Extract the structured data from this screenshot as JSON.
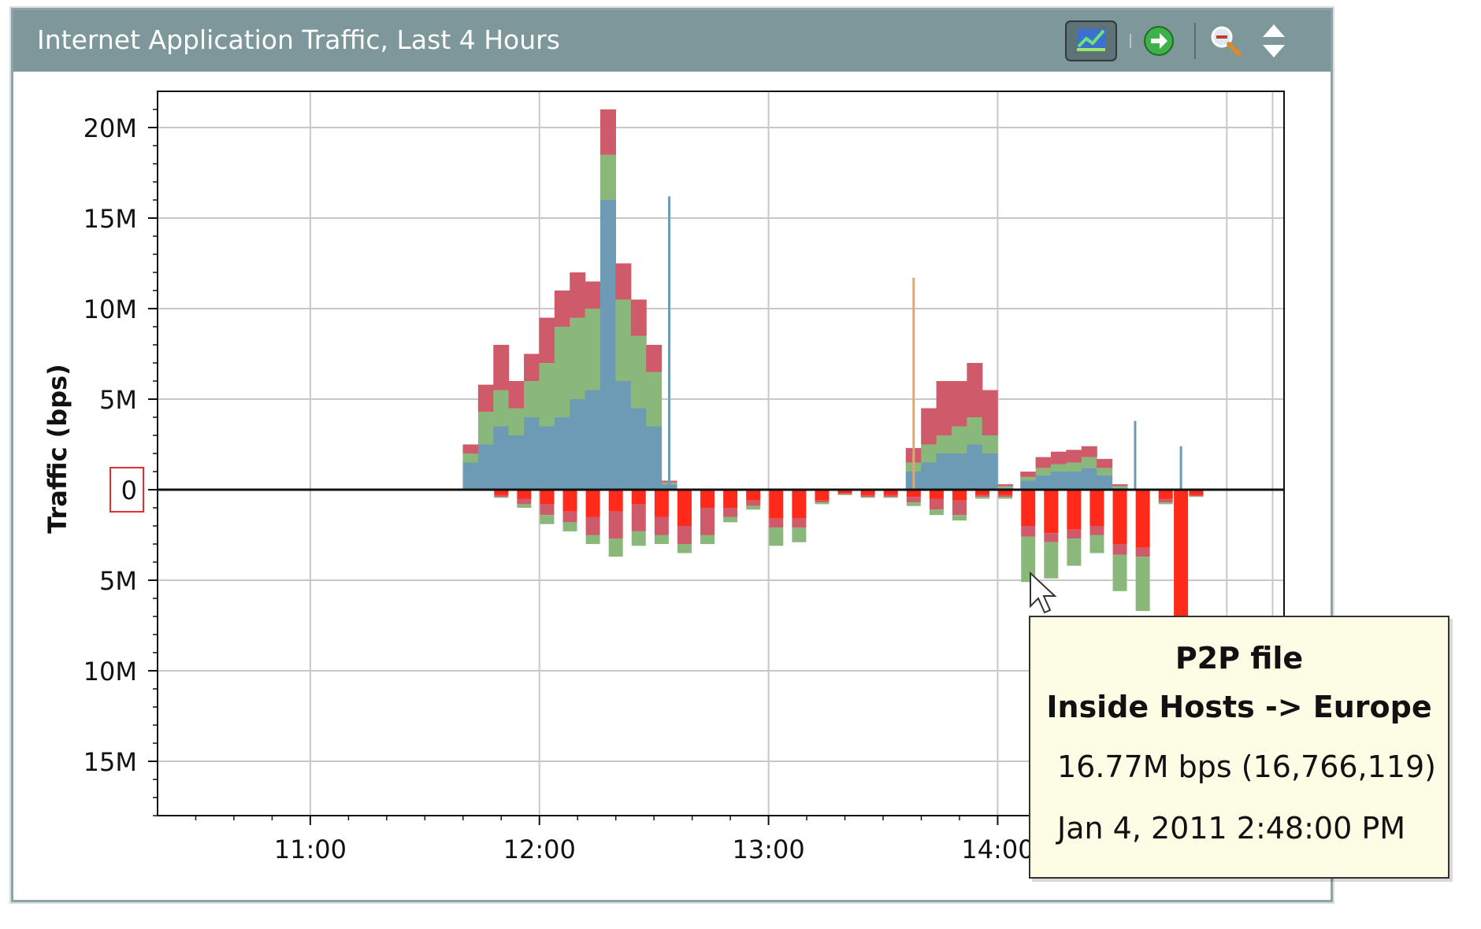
{
  "window": {
    "title": "Internet Application Traffic, Last 4 Hours",
    "toolbar": [
      {
        "icon": "chart-style-icon",
        "active": true
      },
      {
        "icon": "go-arrow-icon",
        "active": false
      },
      {
        "icon": "zoom-out-icon",
        "active": false
      },
      {
        "icon": "expand-collapse-icon",
        "active": false
      }
    ]
  },
  "chart_data": {
    "type": "area",
    "title": "Internet Application Traffic, Last 4 Hours",
    "xlabel": "",
    "ylabel": "Traffic (bps)",
    "x_ticks": [
      "11:00",
      "12:00",
      "13:00",
      "14:00"
    ],
    "xlim": [
      "10:20",
      "15:15"
    ],
    "ylim": [
      -18000000,
      22000000
    ],
    "y_ticks": [
      {
        "value": 20000000,
        "label": "20M"
      },
      {
        "value": 15000000,
        "label": "15M"
      },
      {
        "value": 10000000,
        "label": "10M"
      },
      {
        "value": 5000000,
        "label": "5M"
      },
      {
        "value": 0,
        "label": "0"
      },
      {
        "value": -5000000,
        "label": "5M"
      },
      {
        "value": -10000000,
        "label": "10M"
      },
      {
        "value": -15000000,
        "label": "15M"
      }
    ],
    "grid": true,
    "highlighted_tick": "0",
    "upper_stack": {
      "x": [
        "11:42",
        "11:46",
        "11:50",
        "11:54",
        "11:58",
        "12:02",
        "12:06",
        "12:10",
        "12:14",
        "12:18",
        "12:22",
        "12:26",
        "12:30",
        "12:34"
      ],
      "series": [
        {
          "color": "#6d9bb5",
          "values": [
            1.5,
            2.5,
            3.5,
            3.0,
            4.0,
            3.5,
            4.0,
            5.0,
            5.5,
            16.0,
            6.0,
            4.5,
            3.5,
            0.3
          ]
        },
        {
          "color": "#8ab87a",
          "values": [
            0.5,
            1.8,
            2.0,
            1.5,
            2.0,
            3.5,
            5.0,
            4.5,
            4.5,
            2.5,
            4.5,
            4.0,
            3.0,
            0.1
          ]
        },
        {
          "color": "#cf5a6a",
          "values": [
            0.5,
            1.5,
            2.5,
            1.5,
            1.5,
            2.5,
            2.0,
            2.5,
            1.5,
            2.5,
            2.0,
            2.0,
            1.5,
            0.1
          ]
        }
      ]
    },
    "upper_stack_2": {
      "x": [
        "13:38",
        "13:42",
        "13:46",
        "13:50",
        "13:54",
        "13:58",
        "14:02"
      ],
      "series": [
        {
          "color": "#6d9bb5",
          "values": [
            1.0,
            1.5,
            2.0,
            2.0,
            2.5,
            2.0,
            0.1
          ]
        },
        {
          "color": "#8ab87a",
          "values": [
            0.5,
            1.0,
            1.0,
            1.5,
            1.5,
            1.0,
            0.1
          ]
        },
        {
          "color": "#cf5a6a",
          "values": [
            0.8,
            2.0,
            3.0,
            2.5,
            3.0,
            2.5,
            0.1
          ]
        }
      ]
    },
    "upper_stack_3": {
      "x": [
        "14:08",
        "14:12",
        "14:16",
        "14:20",
        "14:24",
        "14:28",
        "14:32"
      ],
      "series": [
        {
          "color": "#6d9bb5",
          "values": [
            0.5,
            0.8,
            1.0,
            1.0,
            1.2,
            0.8,
            0.1
          ]
        },
        {
          "color": "#8ab87a",
          "values": [
            0.2,
            0.4,
            0.4,
            0.5,
            0.6,
            0.4,
            0.1
          ]
        },
        {
          "color": "#cf5a6a",
          "values": [
            0.3,
            0.6,
            0.7,
            0.7,
            0.6,
            0.5,
            0.1
          ]
        }
      ]
    },
    "spikes": [
      {
        "x": "12:34",
        "value": 16.2,
        "color": "#6d9bb5"
      },
      {
        "x": "13:38",
        "value": 11.7,
        "color": "#d9a97a"
      },
      {
        "x": "14:36",
        "value": 3.8,
        "color": "#6d9bb5"
      },
      {
        "x": "14:48",
        "value": 2.4,
        "color": "#6d9bb5"
      }
    ],
    "lower_stack": {
      "x": [
        "11:50",
        "11:56",
        "12:02",
        "12:08",
        "12:14",
        "12:20",
        "12:26",
        "12:32",
        "12:38",
        "12:44",
        "12:50",
        "12:56",
        "13:02",
        "13:08",
        "13:14",
        "13:20",
        "13:26",
        "13:32",
        "13:38",
        "13:44",
        "13:50",
        "13:56",
        "14:02",
        "14:08",
        "14:14",
        "14:20",
        "14:26",
        "14:32",
        "14:38",
        "14:44",
        "14:48",
        "14:52"
      ],
      "series": [
        {
          "color": "#ff2a1a",
          "values": [
            0.3,
            0.5,
            0.8,
            1.2,
            1.5,
            1.2,
            0.8,
            1.5,
            2.0,
            1.0,
            1.0,
            0.6,
            1.6,
            1.6,
            0.6,
            0.2,
            0.3,
            0.3,
            0.4,
            0.5,
            0.6,
            0.3,
            0.3,
            2.0,
            2.4,
            2.2,
            2.0,
            3.0,
            3.2,
            0.5,
            16.77,
            0.3
          ]
        },
        {
          "color": "#cf5a6a",
          "values": [
            0.1,
            0.3,
            0.6,
            0.6,
            1.0,
            1.5,
            1.5,
            1.0,
            1.0,
            1.5,
            0.5,
            0.3,
            0.5,
            0.5,
            0.1,
            0.05,
            0.1,
            0.1,
            0.3,
            0.6,
            0.8,
            0.1,
            0.1,
            0.6,
            0.5,
            0.5,
            0.5,
            0.6,
            0.5,
            0.2,
            0.0,
            0.05
          ]
        },
        {
          "color": "#8ab87a",
          "values": [
            0.05,
            0.2,
            0.5,
            0.5,
            0.5,
            1.0,
            0.8,
            0.5,
            0.5,
            0.5,
            0.3,
            0.2,
            1.0,
            0.8,
            0.1,
            0.05,
            0.05,
            0.05,
            0.2,
            0.3,
            0.3,
            0.1,
            0.1,
            2.5,
            2.0,
            1.5,
            1.0,
            2.0,
            3.0,
            0.1,
            0.0,
            0.05
          ]
        }
      ]
    },
    "tooltip": {
      "application": "P2P file",
      "direction": "Inside Hosts -> Europe",
      "value_text": "16.77M bps (16,766,119)",
      "time_text": "Jan 4, 2011 2:48:00 PM",
      "value": 16766119,
      "x": "14:48"
    }
  }
}
